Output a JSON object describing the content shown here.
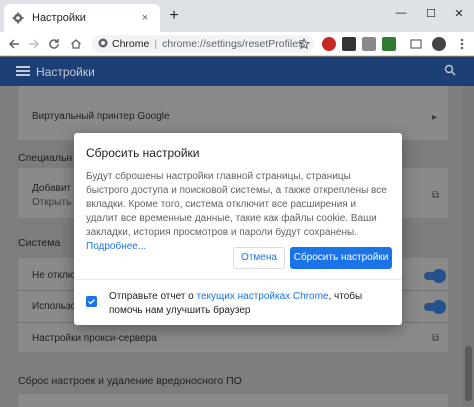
{
  "colors": {
    "accent": "#1a73e8",
    "header_bg": "#1c3f75",
    "tabstrip_bg": "#dee1e6"
  },
  "browser": {
    "tab": {
      "title": "Настройки",
      "favicon": "gear-icon",
      "close": "×"
    },
    "new_tab": "+",
    "window_controls": {
      "minimize": "—",
      "maximize": "☐",
      "close": "✕"
    },
    "omnibox": {
      "site": "Chrome",
      "separator": "|",
      "url": "chrome://settings/resetProfileS..."
    }
  },
  "settings": {
    "header_title": "Настройки",
    "rows": {
      "virtual_printer": "Виртуальный принтер Google",
      "special_section": "Специальн",
      "add_label": "Добавит",
      "open_label": "Открыть и",
      "system_section": "Система",
      "dont_disable": "Не отключ",
      "use_label": "Использов",
      "proxy": "Настройки прокси-сервера",
      "reset_section": "Сброс настроек и удаление вредоносного ПО"
    }
  },
  "dialog": {
    "title": "Сбросить настройки",
    "body": "Будут сброшены настройки главной страницы, страницы быстрого доступа и поисковой системы, а также откреплены все вкладки. Кроме того, система отключит все расширения и удалит все временные данные, такие как файлы cookie. Ваши закладки, история просмотров и пароли будут сохранены.",
    "more_link": "Подробнее...",
    "cancel": "Отмена",
    "reset": "Сбросить настройки",
    "report": {
      "checked": true,
      "prefix": "Отправьте отчет о ",
      "link": "текущих настройках Chrome",
      "suffix": ", чтобы помочь нам улучшить браузер"
    }
  }
}
